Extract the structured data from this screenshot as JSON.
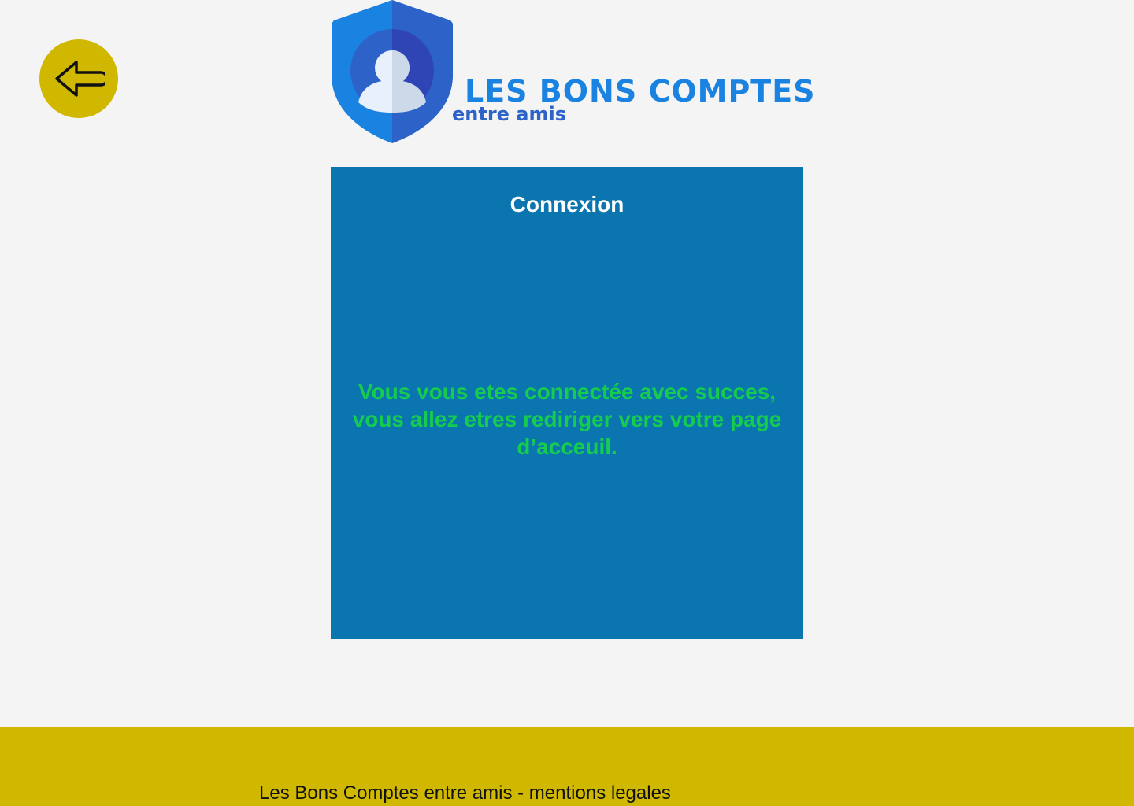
{
  "header": {
    "back_button_icon": "arrow-left-icon",
    "logo": {
      "icon": "shield-user-icon",
      "title": "LES BONS COMPTES",
      "subtitle": "entre amis"
    }
  },
  "login_card": {
    "title": "Connexion",
    "message_line_1": "Vous vous etes connectée avec succes,",
    "message_line_2": "vous allez etres rediriger vers votre page",
    "message_line_3": "d’acceuil."
  },
  "footer": {
    "text": "Les Bons Comptes entre amis - mentions legales"
  },
  "colors": {
    "background": "#f4f4f4",
    "accent_yellow": "#d0b700",
    "card_blue": "#0b75b0",
    "success_green": "#16cc4e",
    "logo_blue": "#1a82e0",
    "logo_dark_blue": "#2d62c8"
  }
}
